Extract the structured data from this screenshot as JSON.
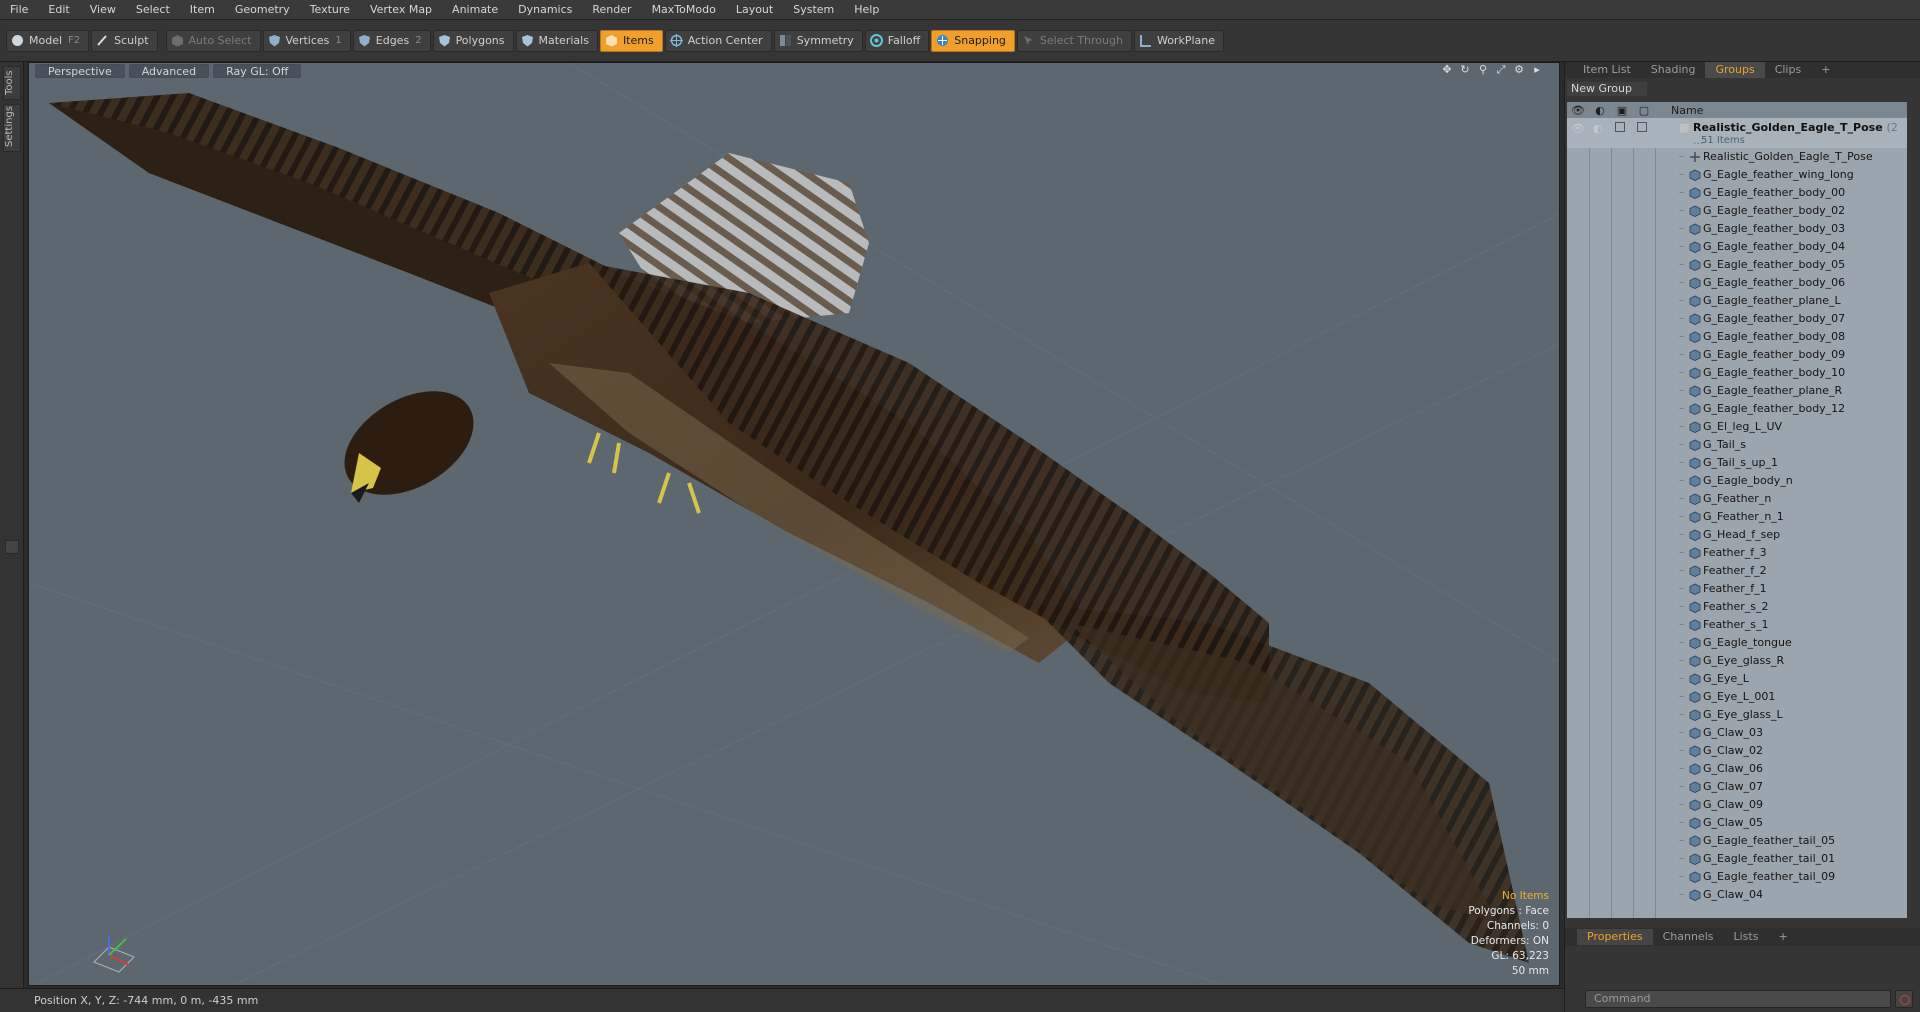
{
  "menu": [
    "File",
    "Edit",
    "View",
    "Select",
    "Item",
    "Geometry",
    "Texture",
    "Vertex Map",
    "Animate",
    "Dynamics",
    "Render",
    "MaxToModo",
    "Layout",
    "System",
    "Help"
  ],
  "toolbar": {
    "model": "Model",
    "model_key": "F2",
    "sculpt": "Sculpt",
    "auto_select": "Auto Select",
    "vertices": "Vertices",
    "vertices_key": "1",
    "edges": "Edges",
    "edges_key": "2",
    "polygons": "Polygons",
    "materials": "Materials",
    "items": "Items",
    "action_center": "Action Center",
    "symmetry": "Symmetry",
    "falloff": "Falloff",
    "snapping": "Snapping",
    "select_through": "Select Through",
    "workplane": "WorkPlane"
  },
  "left_tabs": [
    "Tools",
    "Settings"
  ],
  "viewport": {
    "perspective": "Perspective",
    "advanced": "Advanced",
    "raygl": "Ray GL: Off",
    "hud": {
      "no_items": "No Items",
      "polygons": "Polygons : Face",
      "channels": "Channels: 0",
      "deformers": "Deformers: ON",
      "gl": "GL: 63,223",
      "size": "50 mm"
    }
  },
  "status": "Position X, Y, Z:  -744 mm, 0 m, -435 mm",
  "right_panel": {
    "tabs": [
      "Item List",
      "Shading",
      "Groups",
      "Clips",
      "+"
    ],
    "active_tab": "Groups",
    "new_group": "New Group",
    "column_name": "Name",
    "root_name": "Realistic_Golden_Eagle_T_Pose",
    "root_suffix": "(2 ...",
    "root_count": "51 Items",
    "items": [
      "Realistic_Golden_Eagle_T_Pose",
      "G_Eagle_feather_wing_long",
      "G_Eagle_feather_body_00",
      "G_Eagle_feather_body_02",
      "G_Eagle_feather_body_03",
      "G_Eagle_feather_body_04",
      "G_Eagle_feather_body_05",
      "G_Eagle_feather_body_06",
      "G_Eagle_feather_plane_L",
      "G_Eagle_feather_body_07",
      "G_Eagle_feather_body_08",
      "G_Eagle_feather_body_09",
      "G_Eagle_feather_body_10",
      "G_Eagle_feather_plane_R",
      "G_Eagle_feather_body_12",
      "G_El_leg_L_UV",
      "G_Tail_s",
      "G_Tail_s_up_1",
      "G_Eagle_body_n",
      "G_Feather_n",
      "G_Feather_n_1",
      "G_Head_f_sep",
      "Feather_f_3",
      "Feather_f_2",
      "Feather_f_1",
      "Feather_s_2",
      "Feather_s_1",
      "G_Eagle_tongue",
      "G_Eye_glass_R",
      "G_Eye_L",
      "G_Eye_L_001",
      "G_Eye_glass_L",
      "G_Claw_03",
      "G_Claw_02",
      "G_Claw_06",
      "G_Claw_07",
      "G_Claw_09",
      "G_Claw_05",
      "G_Eagle_feather_tail_05",
      "G_Eagle_feather_tail_01",
      "G_Eagle_feather_tail_09",
      "G_Claw_04"
    ],
    "prop_tabs": [
      "Properties",
      "Channels",
      "Lists",
      "+"
    ],
    "command_placeholder": "Command"
  },
  "colors": {
    "accent": "#f0a02a",
    "viewport_bg": "#5d6770",
    "tree_bg": "#9aa5ae"
  }
}
